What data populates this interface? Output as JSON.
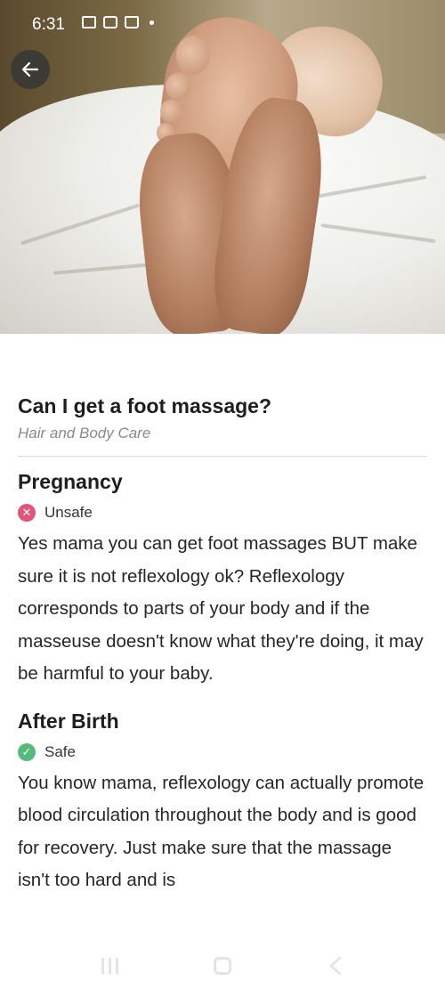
{
  "status_bar": {
    "time": "6:31",
    "icons": [
      "gallery-icon",
      "message-icon",
      "shopping-bag-icon",
      "dot-icon"
    ]
  },
  "hero": {
    "image_subject": "foot massage photo"
  },
  "article": {
    "title": "Can I get a foot massage?",
    "category": "Hair and Body Care",
    "sections": [
      {
        "heading": "Pregnancy",
        "status": "Unsafe",
        "status_color": "#e0567a",
        "text": "Yes mama you can get foot massages BUT make sure it is not reflexology ok? Reflexology corresponds to parts of your body and if the masseuse doesn't know what they're doing, it may be harmful to your baby."
      },
      {
        "heading": "After Birth",
        "status": "Safe",
        "status_color": "#57b97c",
        "text": "You know mama, reflexology can actually promote blood circulation throughout the body and is good for recovery. Just make sure that the massage isn't too hard and is"
      }
    ]
  },
  "nav_bar": {
    "icons": [
      "recents-icon",
      "home-icon",
      "back-icon"
    ]
  }
}
